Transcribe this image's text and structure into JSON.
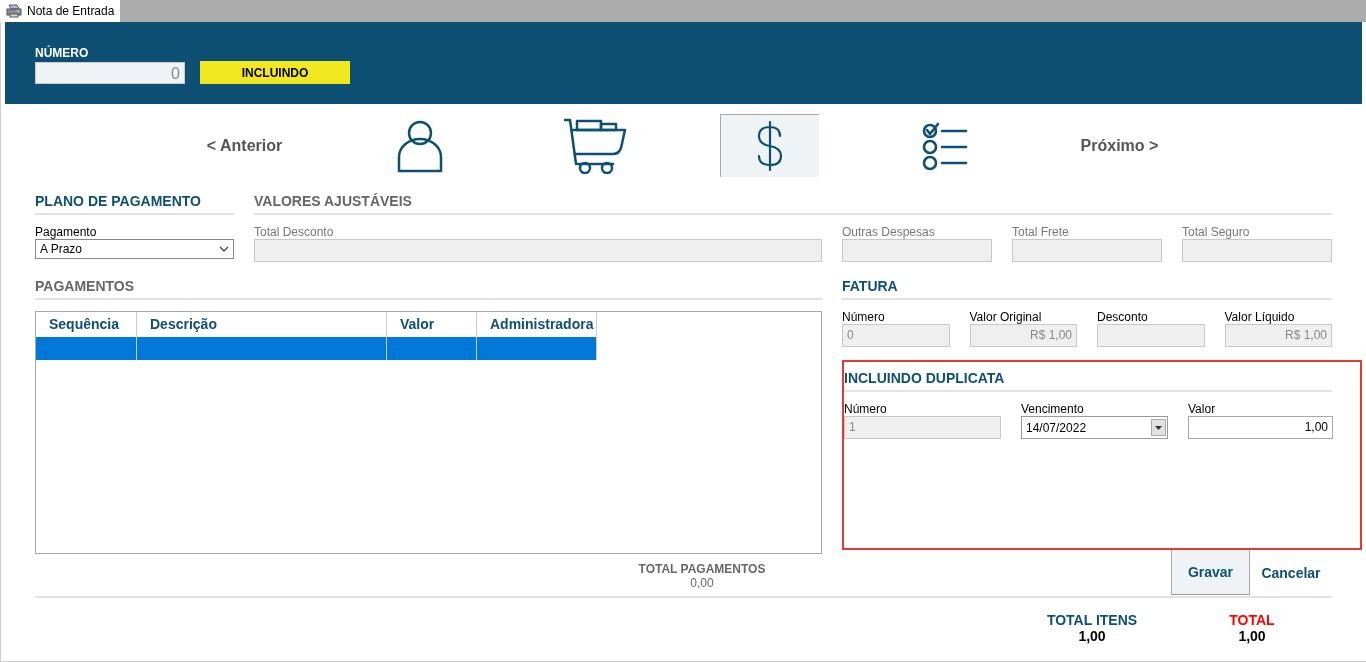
{
  "tab": {
    "title": "Nota de Entrada"
  },
  "header": {
    "number_label": "NÚMERO",
    "number_value": "0",
    "status": "INCLUINDO"
  },
  "nav": {
    "previous": "< Anterior",
    "next": "Próximo >",
    "steps": [
      {
        "kind": "person",
        "selected": false
      },
      {
        "kind": "cart",
        "selected": false
      },
      {
        "kind": "money",
        "selected": true
      },
      {
        "kind": "checklist",
        "selected": false
      }
    ]
  },
  "payment_plan": {
    "title": "PLANO DE PAGAMENTO",
    "field": {
      "label": "Pagamento",
      "value": "A Prazo"
    }
  },
  "adjustable_values": {
    "title": "VALORES AJUSTÁVEIS",
    "disabled": true,
    "fields": [
      {
        "label": "Total Desconto",
        "disabled": true
      },
      {
        "label": "Outras Despesas",
        "disabled": true
      },
      {
        "label": "Total Frete",
        "disabled": true
      },
      {
        "label": "Total Seguro",
        "disabled": true
      }
    ]
  },
  "payments": {
    "title": "PAGAMENTOS",
    "disabled": true,
    "columns": [
      "Sequência",
      "Descrição",
      "Valor",
      "Administradora"
    ],
    "rows": [
      {
        "selected": true
      }
    ],
    "total_label": "TOTAL PAGAMENTOS",
    "total_value": "0,00"
  },
  "invoice": {
    "title": "FATURA",
    "disabled": false,
    "fields": [
      {
        "kind": "text",
        "label": "Número",
        "value": "0",
        "disabled": true
      },
      {
        "kind": "currency",
        "label": "Valor Original",
        "value": "R$ 1,00",
        "disabled": true
      },
      {
        "kind": "currency",
        "label": "Desconto",
        "disabled": true
      },
      {
        "kind": "currency",
        "label": "Valor Líquido",
        "value": "R$ 1,00",
        "disabled": true
      }
    ]
  },
  "duplicate": {
    "title": "INCLUINDO DUPLICATA",
    "highlighted": true,
    "fields": [
      {
        "kind": "text",
        "label": "Número",
        "value": "1",
        "disabled": true
      },
      {
        "kind": "date",
        "label": "Vencimento",
        "value": "14/07/2022",
        "disabled": false
      },
      {
        "kind": "currency",
        "label": "Valor",
        "value": "1,00",
        "disabled": false
      }
    ]
  },
  "buttons": [
    {
      "label": "Gravar",
      "focused": true
    },
    {
      "label": "Cancelar",
      "focused": false
    }
  ],
  "totals": [
    {
      "kind": "normal",
      "label": "TOTAL ITENS",
      "value": "1,00"
    },
    {
      "kind": "emphasis",
      "label": "TOTAL",
      "value": "1,00"
    }
  ]
}
